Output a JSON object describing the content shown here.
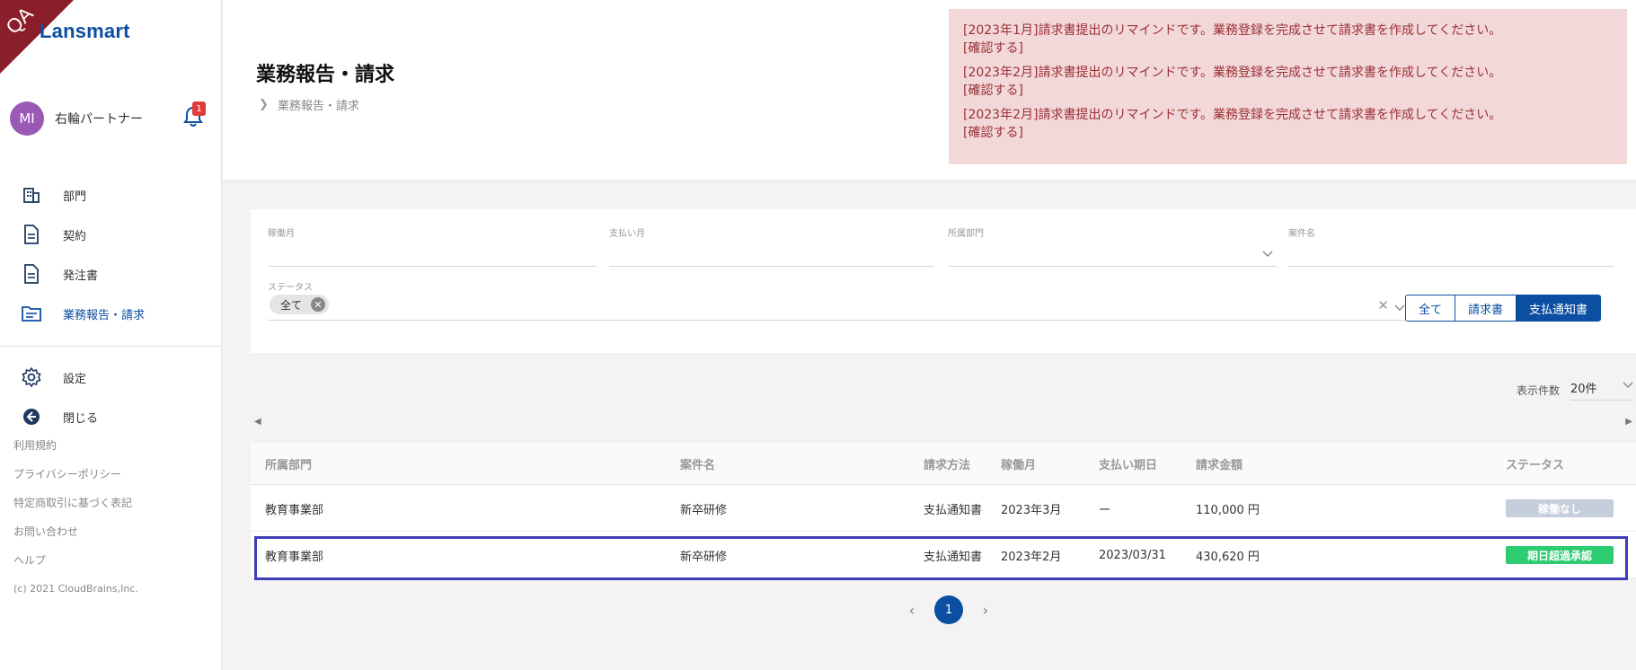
{
  "brand": {
    "qa_label": "QA",
    "logo_text": "Lansmart"
  },
  "user": {
    "initials": "MI",
    "name": "右輪パートナー",
    "notification_count": "1"
  },
  "sidebar": {
    "items": [
      {
        "label": "部門",
        "icon": "building-icon"
      },
      {
        "label": "契約",
        "icon": "document-icon"
      },
      {
        "label": "発注書",
        "icon": "document-icon"
      },
      {
        "label": "業務報告・請求",
        "icon": "folder-icon"
      }
    ],
    "settings_label": "設定",
    "close_label": "閉じる",
    "footer_links": [
      "利用規約",
      "プライバシーポリシー",
      "特定商取引に基づく表記",
      "お問い合わせ",
      "ヘルプ"
    ],
    "copyright": "(c) 2021 CloudBrains,Inc."
  },
  "header": {
    "title": "業務報告・請求",
    "breadcrumb": "業務報告・請求",
    "alerts": [
      {
        "text": "[2023年1月]請求書提出のリマインドです。業務登録を完成させて請求書を作成してください。",
        "link": "[確認する]"
      },
      {
        "text": "[2023年2月]請求書提出のリマインドです。業務登録を完成させて請求書を作成してください。",
        "link": "[確認する]"
      },
      {
        "text": "[2023年2月]請求書提出のリマインドです。業務登録を完成させて請求書を作成してください。",
        "link": "[確認する]"
      }
    ]
  },
  "filters": {
    "work_month_label": "稼働月",
    "payment_month_label": "支払い月",
    "department_label": "所属部門",
    "project_label": "案件名",
    "status_label": "ステータス",
    "status_chip": "全て",
    "toggle": [
      "全て",
      "請求書",
      "支払通知書"
    ],
    "toggle_active": "支払通知書"
  },
  "page_size": {
    "label": "表示件数",
    "value": "20件"
  },
  "table": {
    "columns": [
      "所属部門",
      "案件名",
      "請求方法",
      "稼働月",
      "支払い期日",
      "請求金額",
      "ステータス"
    ],
    "rows": [
      {
        "department": "教育事業部",
        "project": "新卒研修",
        "method": "支払通知書",
        "month": "2023年3月",
        "due": "ー",
        "amount": "110,000 円",
        "status": "稼働なし",
        "status_color": "#c5cfdc"
      },
      {
        "department": "教育事業部",
        "project": "新卒研修",
        "method": "支払通知書",
        "month": "2023年2月",
        "due": "2023/03/31",
        "amount": "430,620 円",
        "status": "期日超過承認",
        "status_color": "#2ecc71"
      }
    ]
  },
  "pagination": {
    "current": "1"
  }
}
